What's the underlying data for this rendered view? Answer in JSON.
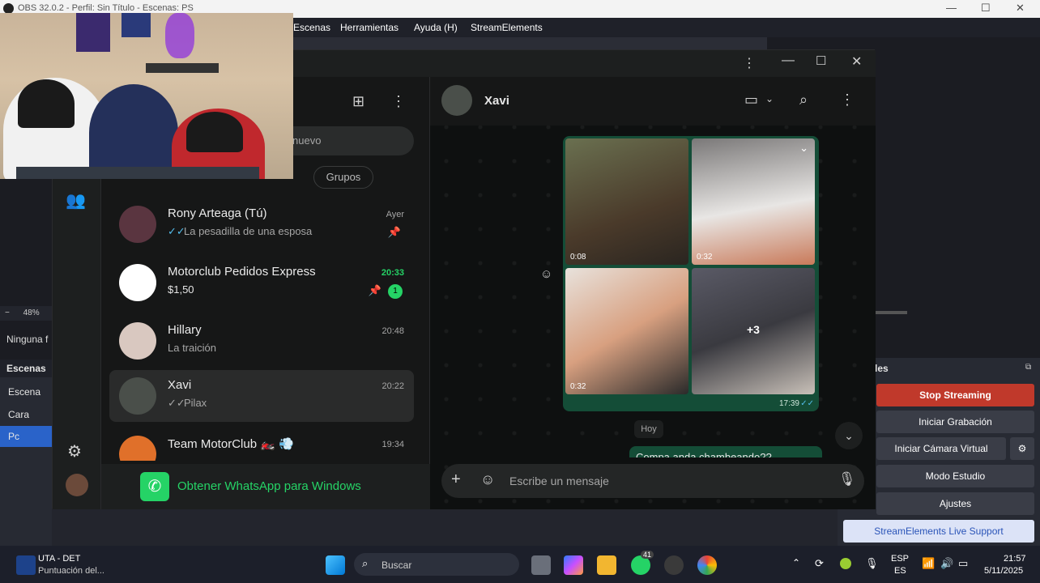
{
  "obs": {
    "title": "OBS 32.0.2 - Perfil: Sin Título - Escenas: PS",
    "menu": [
      "Escenas",
      "Herramientas",
      "Ayuda (H)",
      "StreamElements"
    ],
    "zoom": "48%",
    "source_label": "Ninguna f",
    "scenes_header": "Escenas",
    "scenes": [
      "Escena",
      "Cara",
      "Pc"
    ],
    "controls_header": "les",
    "controls": {
      "stop_streaming": "Stop Streaming",
      "start_recording": "Iniciar Grabación",
      "virtual_camera": "Iniciar Cámara Virtual",
      "studio_mode": "Modo Estudio",
      "settings": "Ajustes",
      "support": "StreamElements Live Support"
    }
  },
  "whatsapp": {
    "search_placeholder_fragment": "nuevo",
    "filter_fragment": "Grupos",
    "chats": [
      {
        "name": "Rony Arteaga (Tú)",
        "preview": "La pesadilla de una esposa",
        "time": "Ayer",
        "ticks": "✓✓",
        "pinned": true
      },
      {
        "name": "Motorclub Pedidos Express",
        "preview": "$1,50",
        "time": "20:33",
        "unread": "1",
        "pinned": true
      },
      {
        "name": "Hillary",
        "preview": "La traición",
        "time": "20:48"
      },
      {
        "name": "Xavi",
        "preview": "Pilax",
        "time": "20:22",
        "ticks": "✓✓",
        "active": true
      },
      {
        "name": "Team MotorClub 🏍️ 💨",
        "preview": "",
        "time": "19:34"
      }
    ],
    "promo": "Obtener WhatsApp para Windows",
    "contact": "Xavi",
    "media": {
      "durations": [
        "0:08",
        "0:32",
        "0:32"
      ],
      "more": "+3",
      "sent_time": "17:39",
      "ticks": "✓✓"
    },
    "day_divider": "Hoy",
    "next_message": "Compa anda chambeando??",
    "input_placeholder": "Escribe un mensaje"
  },
  "taskbar": {
    "news_title": "UTA - DET",
    "news_sub": "Puntuación del...",
    "search": "Buscar",
    "badge": "41",
    "lang": "ESP",
    "lang_sub": "ES",
    "time": "21:57",
    "date": "5/11/2025"
  },
  "colors": {
    "wa_green": "#25d366",
    "bubble_green": "#144d37",
    "stop_red": "#c0392b",
    "support_bg": "#dce3f7"
  }
}
